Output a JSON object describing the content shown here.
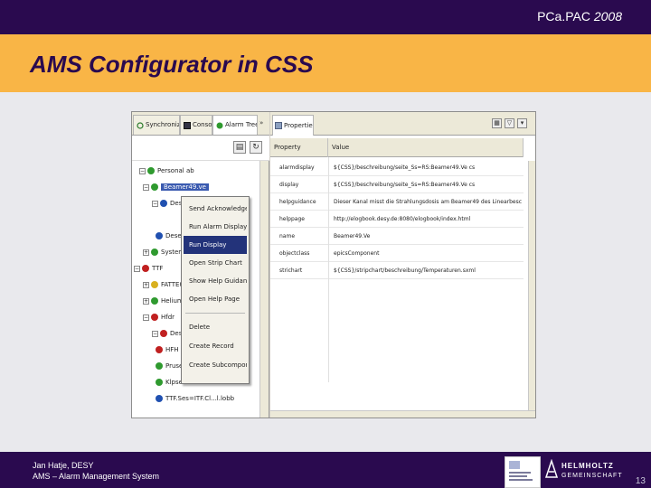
{
  "header": {
    "conference": "PCa.PAC",
    "year": "2008",
    "title": "AMS Configurator in CSS"
  },
  "screenshot": {
    "left_tabs": [
      {
        "label": "Synchronize..."
      },
      {
        "label": "Console"
      },
      {
        "label": "Alarm Tree View"
      }
    ],
    "tree": [
      {
        "label": "Personal ab",
        "color": "green"
      },
      {
        "label": "Beamer49.ve",
        "color": "green",
        "selected": true
      },
      {
        "label": "Dese",
        "color": "blue"
      },
      {
        "label": "Dese",
        "color": "blue"
      },
      {
        "label": "Systeme",
        "color": "green"
      },
      {
        "label": "TTF",
        "color": "red"
      },
      {
        "label": "FATTE0",
        "color": "yellow"
      },
      {
        "label": "Helium_",
        "color": "green"
      },
      {
        "label": "Hfdr",
        "color": "red"
      },
      {
        "label": "Dese",
        "color": "red"
      },
      {
        "label": "HFH",
        "color": "red"
      },
      {
        "label": "Pruser",
        "color": "green"
      },
      {
        "label": "Klpse",
        "color": "green"
      },
      {
        "label": "TTF.Ses=ITF.Cl...l.lobb",
        "color": "blue"
      }
    ],
    "context_menu": [
      {
        "label": "Send Acknowledgement"
      },
      {
        "label": "Run Alarm Display"
      },
      {
        "label": "Run Display",
        "highlighted": true
      },
      {
        "label": "Open Strip Chart"
      },
      {
        "label": "Show Help Guidance"
      },
      {
        "label": "Open Help Page"
      },
      {
        "label": "Delete"
      },
      {
        "label": "Create Record"
      },
      {
        "label": "Create Subcomponent"
      }
    ],
    "properties_tab": "Properties",
    "properties_columns": [
      "Property",
      "Value"
    ],
    "properties": [
      {
        "name": "alarmdisplay",
        "value": "${CSS}/beschreibung/seite_Ss=RS:Beamer49.Ve cs"
      },
      {
        "name": "display",
        "value": "${CSS}/beschreibung/seite_Ss=RS:Beamer49.Ve cs"
      },
      {
        "name": "helpguidance",
        "value": "Dieser Kanal misst die Strahlungsdosis am Beamer49 des Linearbeschleunigers"
      },
      {
        "name": "helppage",
        "value": "http://elogbook.desy.de:8080/elogbook/index.html"
      },
      {
        "name": "name",
        "value": "Beamer49.Ve"
      },
      {
        "name": "objectclass",
        "value": "epicsComponent"
      },
      {
        "name": "strichart",
        "value": "${CSS}/stripchart/beschreibung/Temperaturen.sxml"
      }
    ]
  },
  "footer": {
    "author": "Jan Hatje, DESY",
    "subtitle": "AMS – Alarm Management System",
    "helmholtz": "HELMHOLTZ",
    "gemeinschaft": "GEMEINSCHAFT",
    "page": "13"
  },
  "colors": {
    "purple": "#2a0a4f",
    "orange": "#f9b546",
    "alarm_green": "#2f9a2f",
    "alarm_red": "#c02020",
    "alarm_blue": "#2050b0",
    "alarm_yellow": "#d8b020",
    "menu_highlight": "#23337a"
  }
}
